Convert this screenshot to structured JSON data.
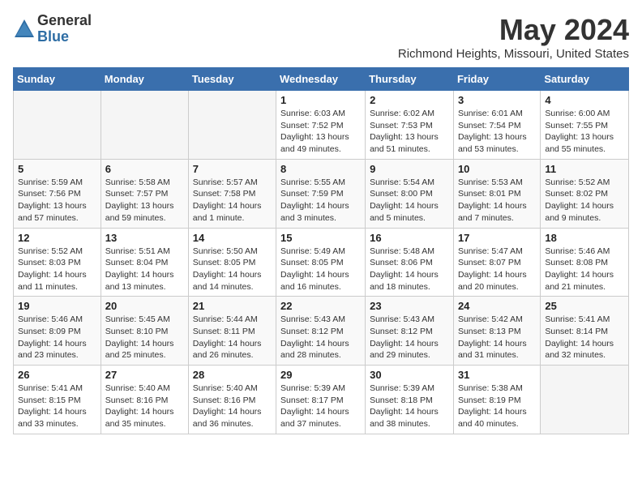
{
  "logo": {
    "general": "General",
    "blue": "Blue"
  },
  "title": "May 2024",
  "location": "Richmond Heights, Missouri, United States",
  "days_header": [
    "Sunday",
    "Monday",
    "Tuesday",
    "Wednesday",
    "Thursday",
    "Friday",
    "Saturday"
  ],
  "weeks": [
    [
      {
        "day": "",
        "info": ""
      },
      {
        "day": "",
        "info": ""
      },
      {
        "day": "",
        "info": ""
      },
      {
        "day": "1",
        "info": "Sunrise: 6:03 AM\nSunset: 7:52 PM\nDaylight: 13 hours\nand 49 minutes."
      },
      {
        "day": "2",
        "info": "Sunrise: 6:02 AM\nSunset: 7:53 PM\nDaylight: 13 hours\nand 51 minutes."
      },
      {
        "day": "3",
        "info": "Sunrise: 6:01 AM\nSunset: 7:54 PM\nDaylight: 13 hours\nand 53 minutes."
      },
      {
        "day": "4",
        "info": "Sunrise: 6:00 AM\nSunset: 7:55 PM\nDaylight: 13 hours\nand 55 minutes."
      }
    ],
    [
      {
        "day": "5",
        "info": "Sunrise: 5:59 AM\nSunset: 7:56 PM\nDaylight: 13 hours\nand 57 minutes."
      },
      {
        "day": "6",
        "info": "Sunrise: 5:58 AM\nSunset: 7:57 PM\nDaylight: 13 hours\nand 59 minutes."
      },
      {
        "day": "7",
        "info": "Sunrise: 5:57 AM\nSunset: 7:58 PM\nDaylight: 14 hours\nand 1 minute."
      },
      {
        "day": "8",
        "info": "Sunrise: 5:55 AM\nSunset: 7:59 PM\nDaylight: 14 hours\nand 3 minutes."
      },
      {
        "day": "9",
        "info": "Sunrise: 5:54 AM\nSunset: 8:00 PM\nDaylight: 14 hours\nand 5 minutes."
      },
      {
        "day": "10",
        "info": "Sunrise: 5:53 AM\nSunset: 8:01 PM\nDaylight: 14 hours\nand 7 minutes."
      },
      {
        "day": "11",
        "info": "Sunrise: 5:52 AM\nSunset: 8:02 PM\nDaylight: 14 hours\nand 9 minutes."
      }
    ],
    [
      {
        "day": "12",
        "info": "Sunrise: 5:52 AM\nSunset: 8:03 PM\nDaylight: 14 hours\nand 11 minutes."
      },
      {
        "day": "13",
        "info": "Sunrise: 5:51 AM\nSunset: 8:04 PM\nDaylight: 14 hours\nand 13 minutes."
      },
      {
        "day": "14",
        "info": "Sunrise: 5:50 AM\nSunset: 8:05 PM\nDaylight: 14 hours\nand 14 minutes."
      },
      {
        "day": "15",
        "info": "Sunrise: 5:49 AM\nSunset: 8:05 PM\nDaylight: 14 hours\nand 16 minutes."
      },
      {
        "day": "16",
        "info": "Sunrise: 5:48 AM\nSunset: 8:06 PM\nDaylight: 14 hours\nand 18 minutes."
      },
      {
        "day": "17",
        "info": "Sunrise: 5:47 AM\nSunset: 8:07 PM\nDaylight: 14 hours\nand 20 minutes."
      },
      {
        "day": "18",
        "info": "Sunrise: 5:46 AM\nSunset: 8:08 PM\nDaylight: 14 hours\nand 21 minutes."
      }
    ],
    [
      {
        "day": "19",
        "info": "Sunrise: 5:46 AM\nSunset: 8:09 PM\nDaylight: 14 hours\nand 23 minutes."
      },
      {
        "day": "20",
        "info": "Sunrise: 5:45 AM\nSunset: 8:10 PM\nDaylight: 14 hours\nand 25 minutes."
      },
      {
        "day": "21",
        "info": "Sunrise: 5:44 AM\nSunset: 8:11 PM\nDaylight: 14 hours\nand 26 minutes."
      },
      {
        "day": "22",
        "info": "Sunrise: 5:43 AM\nSunset: 8:12 PM\nDaylight: 14 hours\nand 28 minutes."
      },
      {
        "day": "23",
        "info": "Sunrise: 5:43 AM\nSunset: 8:12 PM\nDaylight: 14 hours\nand 29 minutes."
      },
      {
        "day": "24",
        "info": "Sunrise: 5:42 AM\nSunset: 8:13 PM\nDaylight: 14 hours\nand 31 minutes."
      },
      {
        "day": "25",
        "info": "Sunrise: 5:41 AM\nSunset: 8:14 PM\nDaylight: 14 hours\nand 32 minutes."
      }
    ],
    [
      {
        "day": "26",
        "info": "Sunrise: 5:41 AM\nSunset: 8:15 PM\nDaylight: 14 hours\nand 33 minutes."
      },
      {
        "day": "27",
        "info": "Sunrise: 5:40 AM\nSunset: 8:16 PM\nDaylight: 14 hours\nand 35 minutes."
      },
      {
        "day": "28",
        "info": "Sunrise: 5:40 AM\nSunset: 8:16 PM\nDaylight: 14 hours\nand 36 minutes."
      },
      {
        "day": "29",
        "info": "Sunrise: 5:39 AM\nSunset: 8:17 PM\nDaylight: 14 hours\nand 37 minutes."
      },
      {
        "day": "30",
        "info": "Sunrise: 5:39 AM\nSunset: 8:18 PM\nDaylight: 14 hours\nand 38 minutes."
      },
      {
        "day": "31",
        "info": "Sunrise: 5:38 AM\nSunset: 8:19 PM\nDaylight: 14 hours\nand 40 minutes."
      },
      {
        "day": "",
        "info": ""
      }
    ]
  ]
}
